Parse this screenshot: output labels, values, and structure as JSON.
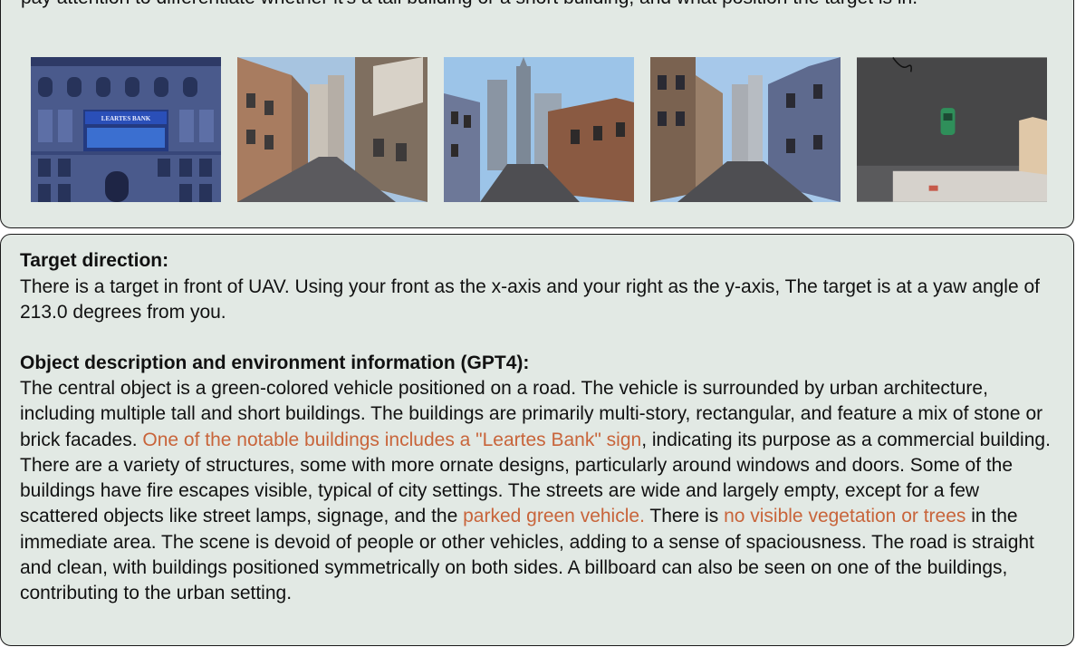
{
  "instruction_text": "pay attention to differentiate whether it's a tall building or a short building, and what position the target is in.",
  "images": [
    {
      "icon": "bank-facade-image",
      "sign_text": "LEARTES BANK"
    },
    {
      "icon": "street-billboard-image"
    },
    {
      "icon": "skyscrapers-street-image"
    },
    {
      "icon": "avenue-view-image"
    },
    {
      "icon": "topdown-car-image"
    }
  ],
  "target_direction": {
    "heading": "Target direction:",
    "text": "There is a target in front of UAV. Using your front as the x-axis and your right as the y-axis, The target is at a yaw angle of 213.0 degrees from you."
  },
  "object_description": {
    "heading": "Object description and environment information (GPT4):",
    "seg1": "The central object is a green-colored vehicle positioned on a road. The vehicle is surrounded by urban architecture, including multiple tall and short buildings. The buildings are primarily multi-story, rectangular, and feature a mix of stone or brick facades. ",
    "hl1": "One of the notable buildings includes a \"Leartes Bank\" sign",
    "seg2": ", indicating its purpose as a commercial building. There are a variety of structures, some with more ornate designs, particularly around windows and doors. Some of the buildings have fire escapes visible, typical of city settings. The streets are wide and largely empty, except for a few scattered objects like street lamps, signage, and the ",
    "hl2": "parked green vehicle.",
    "seg3": " There is ",
    "hl3": "no visible vegetation or trees",
    "seg4": " in the immediate area. The scene is devoid of people or other vehicles, adding to a sense of spaciousness. The road is straight and clean, with buildings positioned symmetrically on both sides. A billboard can also be seen on one of the buildings, contributing to the urban setting."
  },
  "colors": {
    "panel_bg": "#e2e9e4",
    "border": "#1a1a1a",
    "highlight": "#c8643a"
  }
}
